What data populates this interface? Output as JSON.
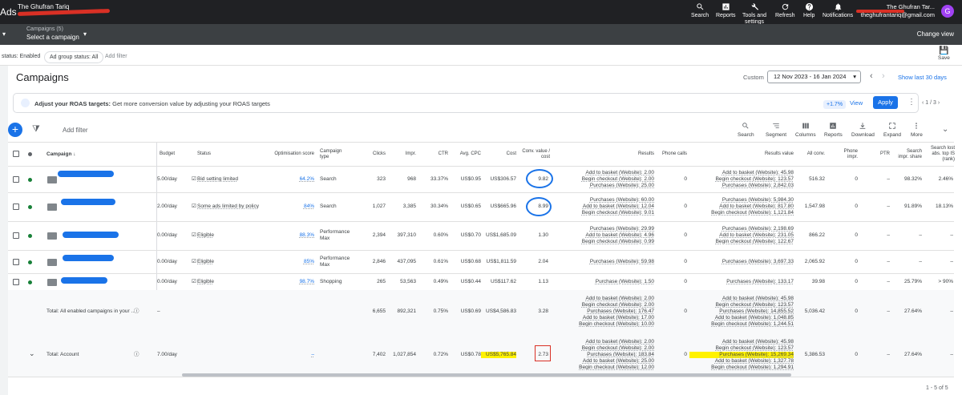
{
  "app": {
    "logo": "Ads",
    "account_name": "The Ghufran Tariq"
  },
  "topbar": {
    "search": "Search",
    "reports": "Reports",
    "tools": "Tools and settings",
    "refresh": "Refresh",
    "help": "Help",
    "notifications": "Notifications",
    "user_name": "The Ghufran Tar...",
    "user_email": "theghufrantariq@gmail.com",
    "avatar_letter": "G"
  },
  "subbar": {
    "campaigns_count": "Campaigns (5)",
    "select_label": "Select a campaign",
    "change_view": "Change view"
  },
  "filters": {
    "status": "status: Enabled",
    "ad_group": "Ad group status: All",
    "add_filter": "Add filter",
    "save": "Save"
  },
  "page": {
    "title": "Campaigns",
    "custom": "Custom",
    "date_range": "12 Nov 2023 - 16 Jan 2024",
    "show_last": "Show last 30 days"
  },
  "banner": {
    "bold": "Adjust your ROAS targets:",
    "text": "Get more conversion value by adjusting your ROAS targets",
    "pct": "+1.7%",
    "view": "View",
    "apply": "Apply",
    "pager": "1 / 3"
  },
  "toolbar": {
    "add_filter": "Add filter",
    "search": "Search",
    "segment": "Segment",
    "columns": "Columns",
    "reports": "Reports",
    "download": "Download",
    "expand": "Expand",
    "more": "More"
  },
  "columns": {
    "campaign": "Campaign",
    "budget": "Budget",
    "status": "Status",
    "opt": "Optimisation score",
    "type": "Campaign type",
    "clicks": "Clicks",
    "impr": "Impr.",
    "ctr": "CTR",
    "cpc": "Avg. CPC",
    "cost": "Cost",
    "convval": "Conv. value / cost",
    "results": "Results",
    "phone": "Phone calls",
    "resval": "Results value",
    "allconv": "All conv.",
    "phoneimpr": "Phone impr.",
    "ptr": "PTR",
    "sis": "Search impr. share",
    "slr": "Search lost abs. top IS (rank)"
  },
  "rows": [
    {
      "budget": "5.00/day",
      "status": "Bid setting limited",
      "opt": "64.2%",
      "type": "Search",
      "clicks": "323",
      "impr": "968",
      "ctr": "33.37%",
      "cpc": "US$0.95",
      "cost": "US$306.57",
      "convval": "9.82",
      "results": [
        "Add to basket (Website): 2.00",
        "Begin checkout (Website): 2.00",
        "Purchases (Website): 25.00"
      ],
      "phone": "0",
      "resval": [
        "Add to basket (Website): 45.98",
        "Begin checkout (Website): 123.57",
        "Purchases (Website): 2,842.03"
      ],
      "allconv": "516.32",
      "phoneimpr": "0",
      "ptr": "–",
      "sis": "98.32%",
      "slr": "2.46%"
    },
    {
      "budget": "2.00/day",
      "status": "Some ads limited by policy",
      "opt": "84%",
      "type": "Search",
      "clicks": "1,027",
      "impr": "3,385",
      "ctr": "30.34%",
      "cpc": "US$0.65",
      "cost": "US$665.96",
      "convval": "8.99",
      "results": [
        "Purchases (Website): 60.00",
        "Add to basket (Website): 12.04",
        "Begin checkout (Website): 9.01"
      ],
      "phone": "0",
      "resval": [
        "Purchases (Website): 5,984.30",
        "Add to basket (Website): 817.80",
        "Begin checkout (Website): 1,121.84"
      ],
      "allconv": "1,547.98",
      "phoneimpr": "0",
      "ptr": "–",
      "sis": "91.89%",
      "slr": "18.13%"
    },
    {
      "budget": "0.00/day",
      "status": "Eligible",
      "opt": "88.3%",
      "type": "Performance Max",
      "clicks": "2,394",
      "impr": "397,310",
      "ctr": "0.60%",
      "cpc": "US$0.70",
      "cost": "US$1,685.09",
      "convval": "1.30",
      "results": [
        "Purchases (Website): 29.99",
        "Add to basket (Website): 4.96",
        "Begin checkout (Website): 0.99"
      ],
      "phone": "0",
      "resval": [
        "Purchases (Website): 2,198.69",
        "Add to basket (Website): 231.05",
        "Begin checkout (Website): 122.67"
      ],
      "allconv": "866.22",
      "phoneimpr": "0",
      "ptr": "–",
      "sis": "–",
      "slr": "–"
    },
    {
      "budget": "0.00/day",
      "status": "Eligible",
      "opt": "85%",
      "type": "Performance Max",
      "clicks": "2,846",
      "impr": "437,095",
      "ctr": "0.61%",
      "cpc": "US$0.68",
      "cost": "US$1,811.59",
      "convval": "2.04",
      "results": [
        "Purchases (Website): 59.98"
      ],
      "phone": "0",
      "resval": [
        "Purchases (Website): 3,697.33"
      ],
      "allconv": "2,065.92",
      "phoneimpr": "0",
      "ptr": "–",
      "sis": "–",
      "slr": "–"
    },
    {
      "budget": "0.00/day",
      "status": "Eligible",
      "opt": "98.7%",
      "type": "Shopping",
      "clicks": "265",
      "impr": "53,563",
      "ctr": "0.49%",
      "cpc": "US$0.44",
      "cost": "US$117.62",
      "convval": "1.13",
      "results": [
        "Purchase (Website): 1.50"
      ],
      "phone": "0",
      "resval": [
        "Purchases (Website): 133.17"
      ],
      "allconv": "39.98",
      "phoneimpr": "0",
      "ptr": "–",
      "sis": "25.79%",
      "slr": "> 90%"
    }
  ],
  "total_enabled": {
    "label": "Total: All enabled campaigns in your ...",
    "budget": "–",
    "clicks": "6,655",
    "impr": "892,321",
    "ctr": "0.75%",
    "cpc": "US$0.69",
    "cost": "US$4,586.83",
    "convval": "3.28",
    "results": [
      "Add to basket (Website): 2.00",
      "Begin checkout (Website): 2.00",
      "Purchases (Website): 176.47",
      "Add to basket (Website): 17.00",
      "Begin checkout (Website): 10.00"
    ],
    "phone": "0",
    "resval": [
      "Add to basket (Website): 45.98",
      "Begin checkout (Website): 123.57",
      "Purchases (Website): 14,855.52",
      "Add to basket (Website): 1,048.85",
      "Begin checkout (Website): 1,244.51"
    ],
    "allconv": "5,036.42",
    "phoneimpr": "0",
    "ptr": "–",
    "sis": "27.64%",
    "slr": "–"
  },
  "total_account": {
    "label": "Total: Account",
    "budget": "7.00/day",
    "opt": "–",
    "clicks": "7,402",
    "impr": "1,027,854",
    "ctr": "0.72%",
    "cpc": "US$0.78",
    "cost": "US$5,765.84",
    "convval": "2.73",
    "results": [
      "Add to basket (Website): 2.00",
      "Begin checkout (Website): 2.00",
      "Purchases (Website): 183.84",
      "Add to basket (Website): 25.00",
      "Begin checkout (Website): 12.00"
    ],
    "phone": "0",
    "resval": [
      "Add to basket (Website): 45.98",
      "Begin checkout (Website): 123.57",
      "Purchases (Website): 15,269.34",
      "Add to basket (Website): 1,327.78",
      "Begin checkout (Website): 1,294.91"
    ],
    "allconv": "5,386.53",
    "phoneimpr": "0",
    "ptr": "–",
    "sis": "27.64%",
    "slr": "–"
  },
  "footer": {
    "range": "1 - 5 of 5"
  },
  "colors": {
    "accent": "#1a73e8",
    "topbar": "#202124",
    "enabled_dot": "#188038",
    "highlight": "#fff200",
    "annotation_red": "#d93025"
  }
}
